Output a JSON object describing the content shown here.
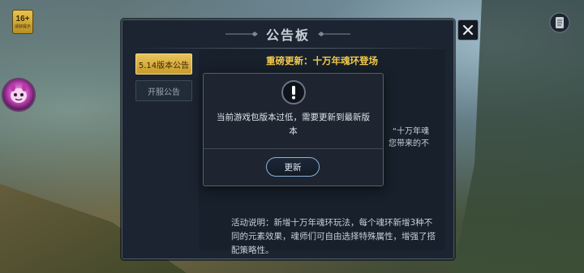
{
  "age_badge": {
    "rating": "16+",
    "label": "适龄提示"
  },
  "notice_board": {
    "title": "公告板",
    "tabs": [
      {
        "label": "5.14版本公告",
        "selected": true
      },
      {
        "label": "开服公告",
        "selected": false
      }
    ],
    "content": {
      "heading": "重磅更新：十万年魂环登场",
      "fragment_line1": "“十万年魂",
      "fragment_line2": "您带来的不",
      "body": "活动说明：新增十万年魂环玩法，每个魂环新增3种不同的元素效果，魂师们可自由选择特殊属性，增强了搭配策略性。"
    }
  },
  "dialog": {
    "message": "当前游戏包版本过低，需要更新到最新版本",
    "button_label": "更新"
  },
  "icons": {
    "close": "close-icon",
    "alert": "exclamation-icon",
    "avatar": "character-avatar-icon",
    "scroll": "scroll-icon"
  },
  "colors": {
    "accent_gold": "#f2c94c",
    "tab_active": "#e8c45a",
    "panel_bg": "#1b2430",
    "button_border": "#8fb0d6"
  }
}
